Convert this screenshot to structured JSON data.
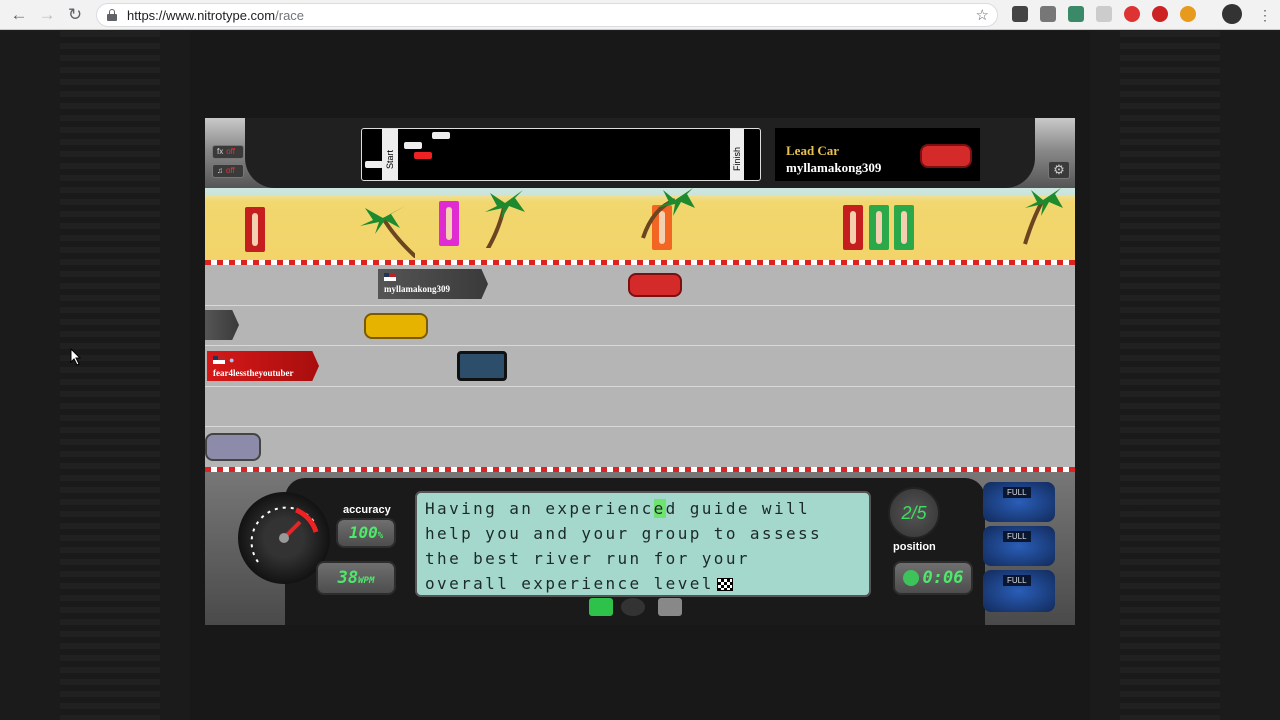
{
  "browser": {
    "url_domain": "https://www.nitrotype.com",
    "url_path": "/race"
  },
  "game": {
    "sound_buttons": [
      {
        "icon": "fx",
        "state": "off"
      },
      {
        "icon": "music-note",
        "state": "off"
      }
    ],
    "track_map": {
      "start_label": "Start",
      "finish_label": "Finish"
    },
    "lead_car": {
      "title": "Lead Car",
      "name": "myllamakong309"
    },
    "racers": [
      {
        "name": "myllamakong309",
        "flag": "us",
        "car_color": "#d42a2a"
      },
      {
        "name": "",
        "car_color": "#e6b400"
      },
      {
        "name": "fear4lesstheyoutuber",
        "flag": "us",
        "is_player": true,
        "car_color": "#2c4e6a"
      },
      {
        "name": "",
        "car_color": "#8c8caa"
      }
    ],
    "stats": {
      "accuracy_label": "accuracy",
      "accuracy_value": "100",
      "accuracy_unit": "%",
      "wpm_value": "38",
      "wpm_unit": "WPM",
      "position_label": "position",
      "position_value": "2/5",
      "timer_value": "0:06"
    },
    "typing_text": {
      "lines": [
        "Having an experienced guide will",
        "help you and your group to assess",
        "the best river run for your",
        "overall experience level"
      ],
      "highlight_char": "e"
    },
    "nitros": [
      "FULL",
      "FULL",
      "FULL"
    ]
  }
}
